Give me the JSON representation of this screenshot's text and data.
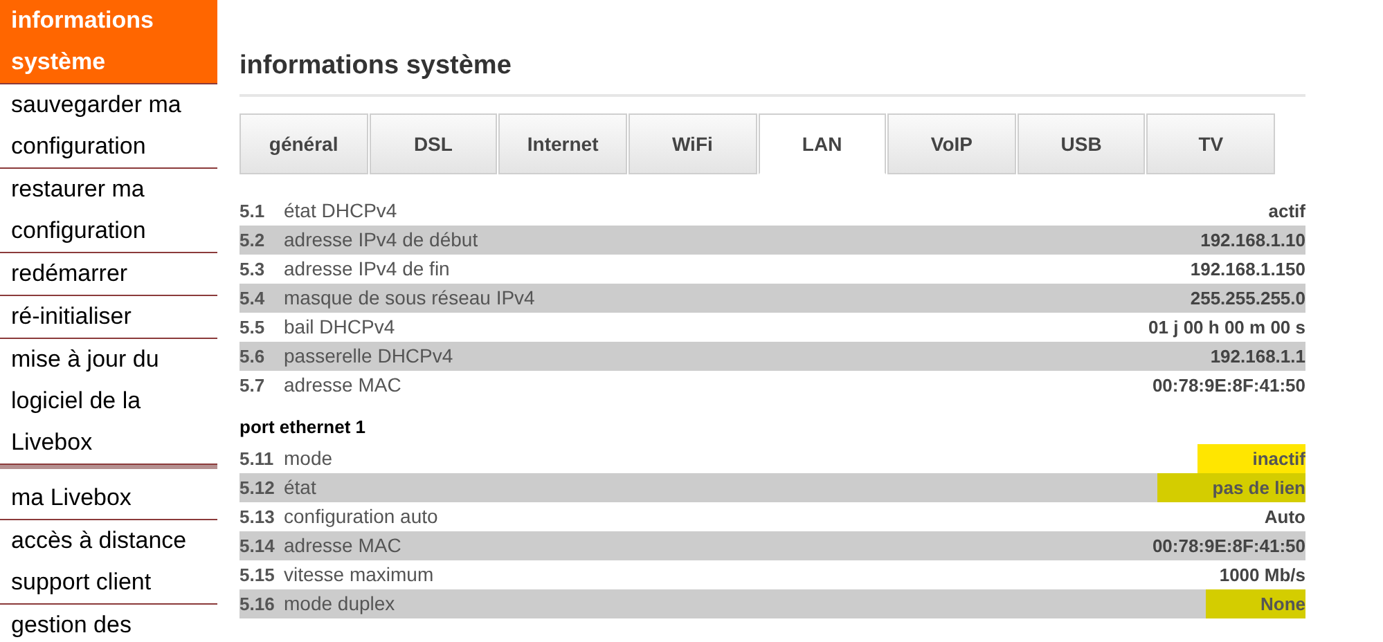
{
  "sidebar": {
    "items": [
      {
        "label": "informations système",
        "selected": true,
        "kind": "link"
      },
      {
        "label": "sauvegarder ma configuration",
        "selected": false,
        "kind": "link"
      },
      {
        "label": "restaurer ma configuration",
        "selected": false,
        "kind": "link"
      },
      {
        "label": "redémarrer",
        "selected": false,
        "kind": "link"
      },
      {
        "label": "ré-initialiser",
        "selected": false,
        "kind": "link"
      },
      {
        "label": "mise à jour du logiciel de la Livebox",
        "selected": false,
        "kind": "link"
      },
      {
        "kind": "spacer"
      },
      {
        "label": "ma Livebox",
        "selected": false,
        "kind": "link"
      },
      {
        "label": "accès à distance support client",
        "selected": false,
        "kind": "link"
      },
      {
        "label": "gestion des",
        "selected": false,
        "kind": "link"
      }
    ]
  },
  "title": "informations système",
  "tabs": [
    {
      "label": "général",
      "selected": false
    },
    {
      "label": "DSL",
      "selected": false
    },
    {
      "label": "Internet",
      "selected": false
    },
    {
      "label": "WiFi",
      "selected": false
    },
    {
      "label": "LAN",
      "selected": true
    },
    {
      "label": "VoIP",
      "selected": false
    },
    {
      "label": "USB",
      "selected": false
    },
    {
      "label": "TV",
      "selected": false
    }
  ],
  "sections": [
    {
      "rows": [
        {
          "num": "5.1",
          "label": "état DHCPv4",
          "value": "actif",
          "highlighted": false
        },
        {
          "num": "5.2",
          "label": "adresse IPv4 de début",
          "value": "192.168.1.10",
          "highlighted": false
        },
        {
          "num": "5.3",
          "label": "adresse IPv4 de fin",
          "value": "192.168.1.150",
          "highlighted": false
        },
        {
          "num": "5.4",
          "label": "masque de sous réseau IPv4",
          "value": "255.255.255.0",
          "highlighted": false
        },
        {
          "num": "5.5",
          "label": "bail DHCPv4",
          "value": "01 j 00 h 00 m 00 s",
          "highlighted": false
        },
        {
          "num": "5.6",
          "label": "passerelle DHCPv4",
          "value": "192.168.1.1",
          "highlighted": false
        },
        {
          "num": "5.7",
          "label": "adresse MAC",
          "value": "00:78:9E:8F:41:50",
          "highlighted": false
        }
      ]
    },
    {
      "heading": "port ethernet 1",
      "rows": [
        {
          "num": "5.11",
          "label": "mode",
          "value": "inactif",
          "highlighted": true
        },
        {
          "num": "5.12",
          "label": "état",
          "value": "pas de lien",
          "highlighted": true
        },
        {
          "num": "5.13",
          "label": "configuration auto",
          "value": "Auto",
          "highlighted": false
        },
        {
          "num": "5.14",
          "label": "adresse MAC",
          "value": "00:78:9E:8F:41:50",
          "highlighted": false
        },
        {
          "num": "5.15",
          "label": "vitesse maximum",
          "value": "1000 Mb/s",
          "highlighted": false
        },
        {
          "num": "5.16",
          "label": "mode duplex",
          "value": "None",
          "highlighted": true
        }
      ]
    }
  ]
}
